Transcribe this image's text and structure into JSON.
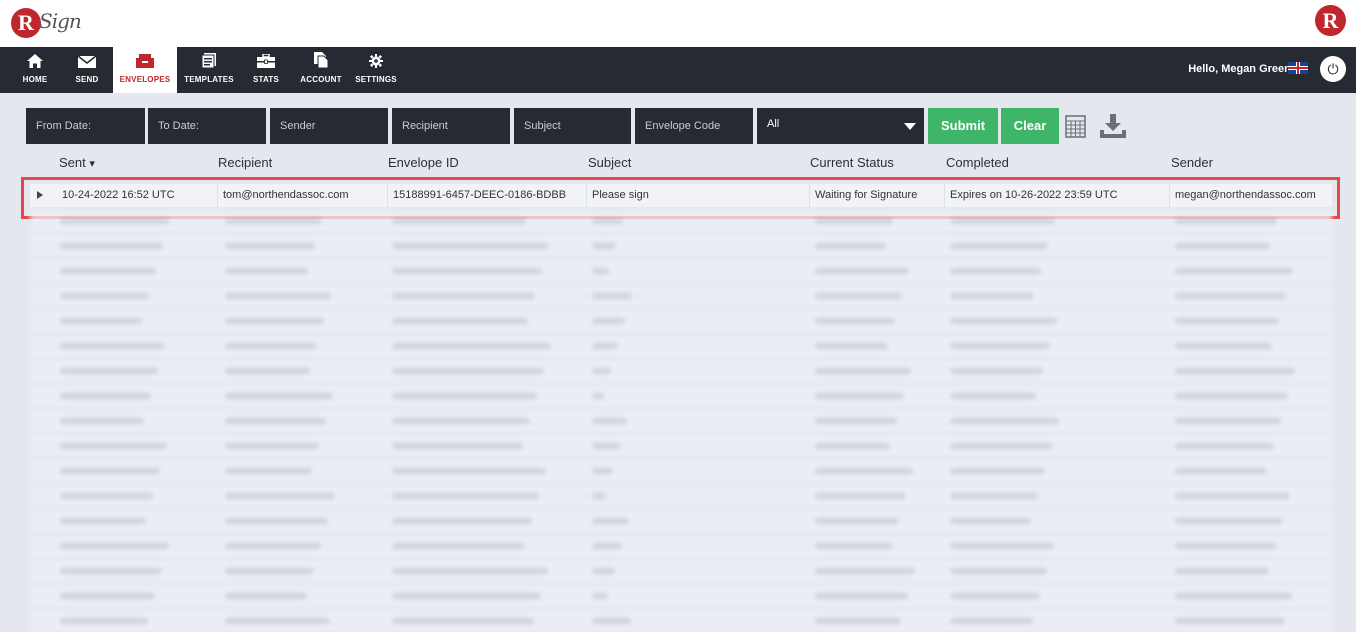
{
  "brand": {
    "logo_letter": "R",
    "logo_text": "Sign",
    "logo_right_letter": "R"
  },
  "nav": {
    "items": [
      {
        "label": "HOME",
        "icon": "home-icon"
      },
      {
        "label": "SEND",
        "icon": "envelope-icon"
      },
      {
        "label": "ENVELOPES",
        "icon": "envelopes-icon",
        "active": true
      },
      {
        "label": "TEMPLATES",
        "icon": "templates-icon"
      },
      {
        "label": "STATS",
        "icon": "briefcase-icon"
      },
      {
        "label": "ACCOUNT",
        "icon": "account-icon"
      },
      {
        "label": "SETTINGS",
        "icon": "gear-icon"
      }
    ],
    "greeting": "Hello, Megan Greene",
    "flag_icon": "uk-flag-icon",
    "power_icon": "power-icon"
  },
  "filters": {
    "from_date": "From Date:",
    "to_date": "To Date:",
    "sender": "Sender",
    "recipient": "Recipient",
    "subject": "Subject",
    "envelope_code": "Envelope Code",
    "status_selected": "All",
    "submit": "Submit",
    "clear": "Clear",
    "calculator_icon": "calculator-icon",
    "download_icon": "download-icon"
  },
  "table": {
    "columns": [
      "Sent",
      "Recipient",
      "Envelope ID",
      "Subject",
      "Current Status",
      "Completed",
      "Sender"
    ],
    "sort_indicator": "▾",
    "rows": [
      {
        "sent": "10-24-2022 16:52 UTC",
        "recipient": "tom@northendassoc.com",
        "envelope_id": "15188991-6457-DEEC-0186-BDBB",
        "subject": "Please sign",
        "status": "Waiting for Signature",
        "completed": "Expires on 10-26-2022 23:59 UTC",
        "sender": "megan@northendassoc.com"
      }
    ]
  },
  "colors": {
    "brand_red": "#c0272d",
    "nav_bg": "#252a33",
    "accent_green": "#3fb56a",
    "highlight_border": "#e0484d"
  }
}
